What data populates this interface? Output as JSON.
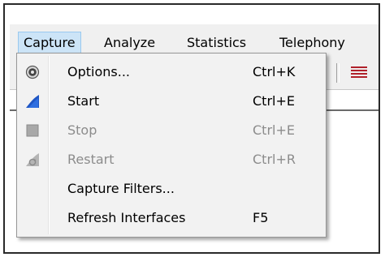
{
  "menubar": {
    "items": [
      {
        "label": "Capture",
        "active": true
      },
      {
        "label": "Analyze",
        "active": false
      },
      {
        "label": "Statistics",
        "active": false
      },
      {
        "label": "Telephony",
        "active": false
      }
    ]
  },
  "dropdown": {
    "items": [
      {
        "label": "Options...",
        "shortcut": "Ctrl+K",
        "icon": "gear-icon",
        "enabled": true
      },
      {
        "label": "Start",
        "shortcut": "Ctrl+E",
        "icon": "shark-fin-icon",
        "enabled": true
      },
      {
        "label": "Stop",
        "shortcut": "Ctrl+E",
        "icon": "stop-icon",
        "enabled": false
      },
      {
        "label": "Restart",
        "shortcut": "Ctrl+R",
        "icon": "restart-icon",
        "enabled": false
      },
      {
        "label": "Capture Filters...",
        "shortcut": "",
        "icon": "",
        "enabled": true
      },
      {
        "label": "Refresh Interfaces",
        "shortcut": "F5",
        "icon": "",
        "enabled": true
      }
    ]
  },
  "toolbar": {
    "icons": [
      "list-icon"
    ]
  },
  "colors": {
    "menu_highlight": "#cce4f7",
    "menu_highlight_border": "#99c9ef",
    "shark_fin": "#1f56c4",
    "disabled_text": "#8c8c8c"
  }
}
